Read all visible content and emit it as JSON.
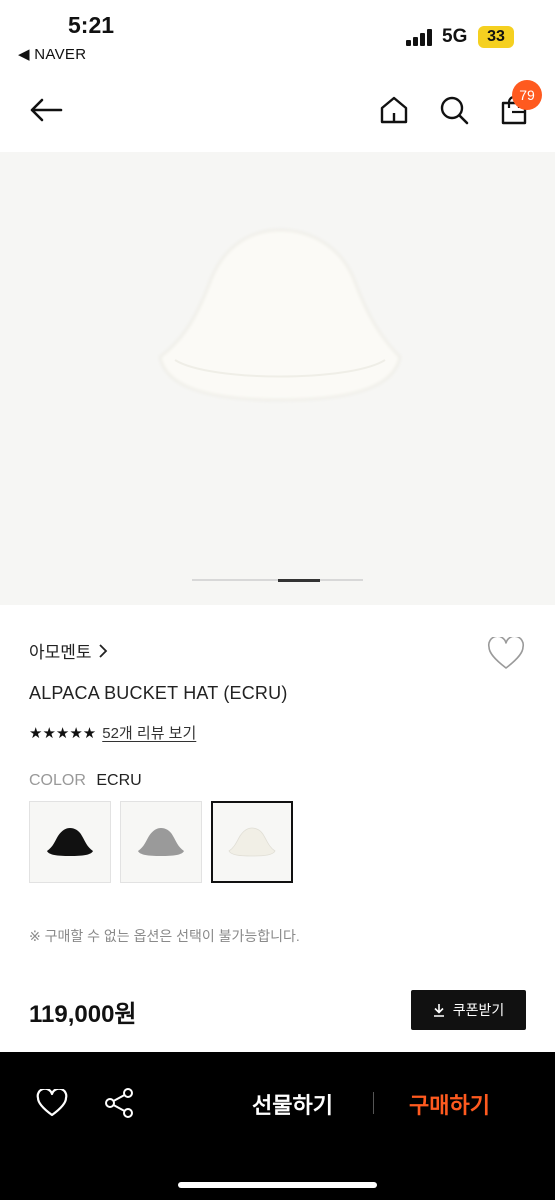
{
  "status_bar": {
    "time": "5:21",
    "back_app": "◀ NAVER",
    "network": "5G",
    "battery": "33"
  },
  "header": {
    "cart_count": "79",
    "icons": [
      "back-arrow-icon",
      "home-icon",
      "search-icon",
      "shopping-bag-icon"
    ]
  },
  "product": {
    "brand": "아모멘토",
    "title": "ALPACA BUCKET HAT (ECRU)",
    "stars": "★★★★★",
    "rating": 5,
    "review_link": "52개 리뷰 보기",
    "color_label": "COLOR",
    "color_value": "ECRU",
    "options": [
      {
        "name": "black",
        "color": "#111111"
      },
      {
        "name": "grey",
        "color": "#9a9a9a"
      },
      {
        "name": "ecru",
        "color": "#f1efe6",
        "selected": true
      }
    ],
    "notice": "※ 구매할 수 없는 옵션은 선택이 불가능합니다.",
    "price": "119,000원",
    "coupon_label": "쿠폰받기"
  },
  "gallery": {
    "image_color": "#fbfaf6",
    "background": "#f6f6f4"
  },
  "bottom_bar": {
    "gift_label": "선물하기",
    "buy_label": "구매하기",
    "buy_color": "#ff5a1f"
  }
}
